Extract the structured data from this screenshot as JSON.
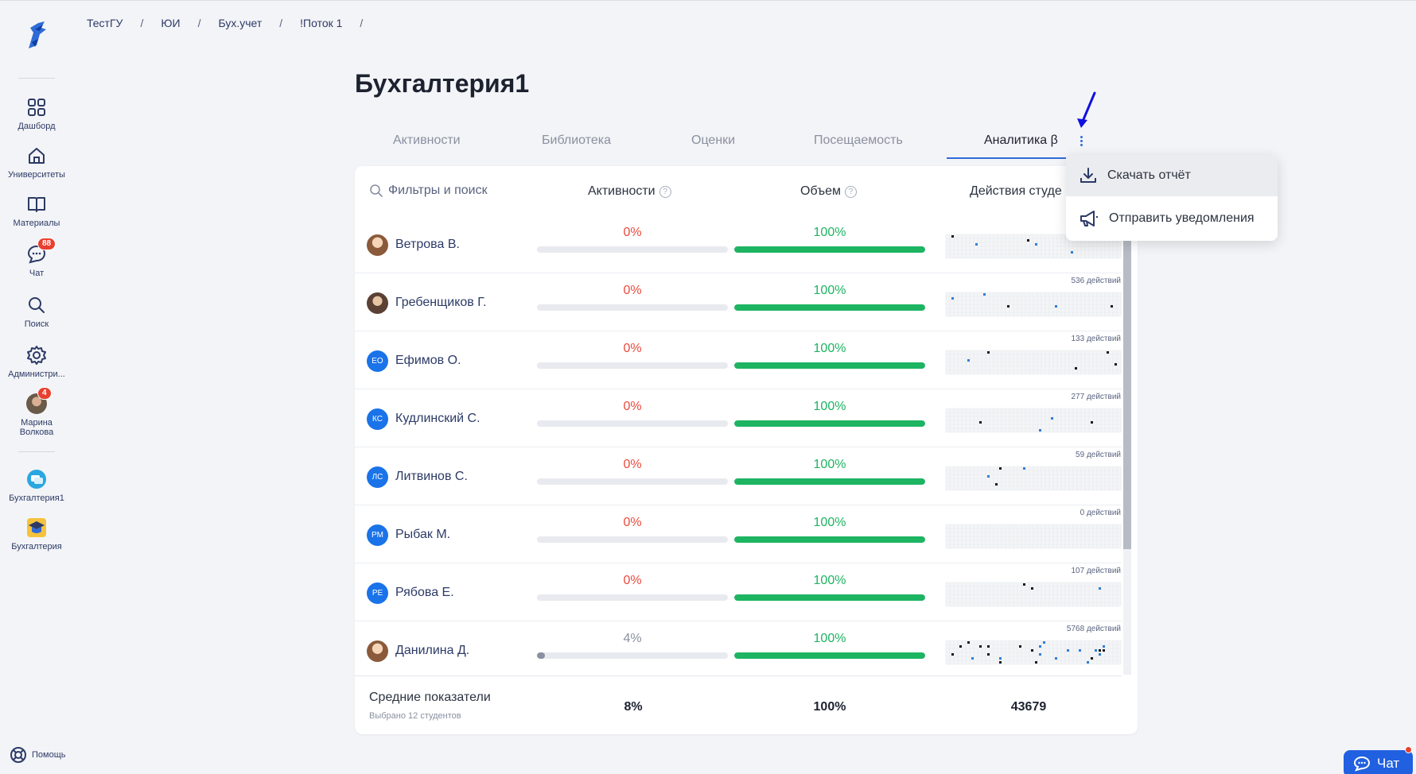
{
  "sidebar": {
    "items": [
      {
        "label": "Дашборд",
        "icon": "grid-icon"
      },
      {
        "label": "Университеты",
        "icon": "home-icon"
      },
      {
        "label": "Материалы",
        "icon": "book-icon"
      },
      {
        "label": "Чат",
        "icon": "chat-icon",
        "badge": "88"
      },
      {
        "label": "Поиск",
        "icon": "search-icon"
      },
      {
        "label": "Администри...",
        "icon": "gear-icon"
      },
      {
        "label": "Марина Волкова",
        "icon": "avatar",
        "badge": "4"
      }
    ],
    "courses": [
      {
        "label": "Бухгалтерия1",
        "icon": "course-chat-icon"
      },
      {
        "label": "Бухгалтерия",
        "icon": "course-graduation-icon"
      }
    ],
    "help_label": "Помощь"
  },
  "breadcrumb": [
    "ТестГУ",
    "ЮИ",
    "Бух.учет",
    "!Поток 1"
  ],
  "page_title": "Бухгалтерия1",
  "tabs": [
    "Активности",
    "Библиотека",
    "Оценки",
    "Посещаемость",
    "Аналитика β"
  ],
  "active_tab": "Аналитика β",
  "table": {
    "search_placeholder": "Фильтры и поиск",
    "col_activities": "Активности",
    "col_volume": "Объем",
    "col_actions": "Действия студе",
    "rows": [
      {
        "name": "Ветрова В.",
        "avatar": "photo",
        "initials": "",
        "activity": "0%",
        "activity_value": 0,
        "volume": "100%",
        "volume_value": 100,
        "actions_count": ""
      },
      {
        "name": "Гребенщиков Г.",
        "avatar": "photo2",
        "initials": "",
        "activity": "0%",
        "activity_value": 0,
        "volume": "100%",
        "volume_value": 100,
        "actions_count": "536 действий"
      },
      {
        "name": "Ефимов О.",
        "avatar": "initials",
        "initials": "ЕО",
        "activity": "0%",
        "activity_value": 0,
        "volume": "100%",
        "volume_value": 100,
        "actions_count": "133 действий"
      },
      {
        "name": "Кудлинский С.",
        "avatar": "initials",
        "initials": "КС",
        "activity": "0%",
        "activity_value": 0,
        "volume": "100%",
        "volume_value": 100,
        "actions_count": "277 действий"
      },
      {
        "name": "Литвинов С.",
        "avatar": "initials",
        "initials": "ЛС",
        "activity": "0%",
        "activity_value": 0,
        "volume": "100%",
        "volume_value": 100,
        "actions_count": "59 действий"
      },
      {
        "name": "Рыбак М.",
        "avatar": "initials",
        "initials": "РМ",
        "activity": "0%",
        "activity_value": 0,
        "volume": "100%",
        "volume_value": 100,
        "actions_count": "0 действий"
      },
      {
        "name": "Рябова Е.",
        "avatar": "initials",
        "initials": "РЕ",
        "activity": "0%",
        "activity_value": 0,
        "volume": "100%",
        "volume_value": 100,
        "actions_count": "107 действий"
      },
      {
        "name": "Данилина Д.",
        "avatar": "photo",
        "initials": "",
        "activity": "4%",
        "activity_value": 4,
        "volume": "100%",
        "volume_value": 100,
        "actions_count": "5768 действий"
      }
    ],
    "footer": {
      "title": "Средние показатели",
      "subtitle": "Выбрано 12 студентов",
      "activity": "8%",
      "volume": "100%",
      "actions": "43679"
    }
  },
  "menu": {
    "download_label": "Скачать отчёт",
    "notify_label": "Отправить уведомления"
  },
  "chat_button_label": "Чат",
  "colors": {
    "accent": "#2f6bd8",
    "green": "#1db462",
    "red": "#ea4a3c"
  }
}
